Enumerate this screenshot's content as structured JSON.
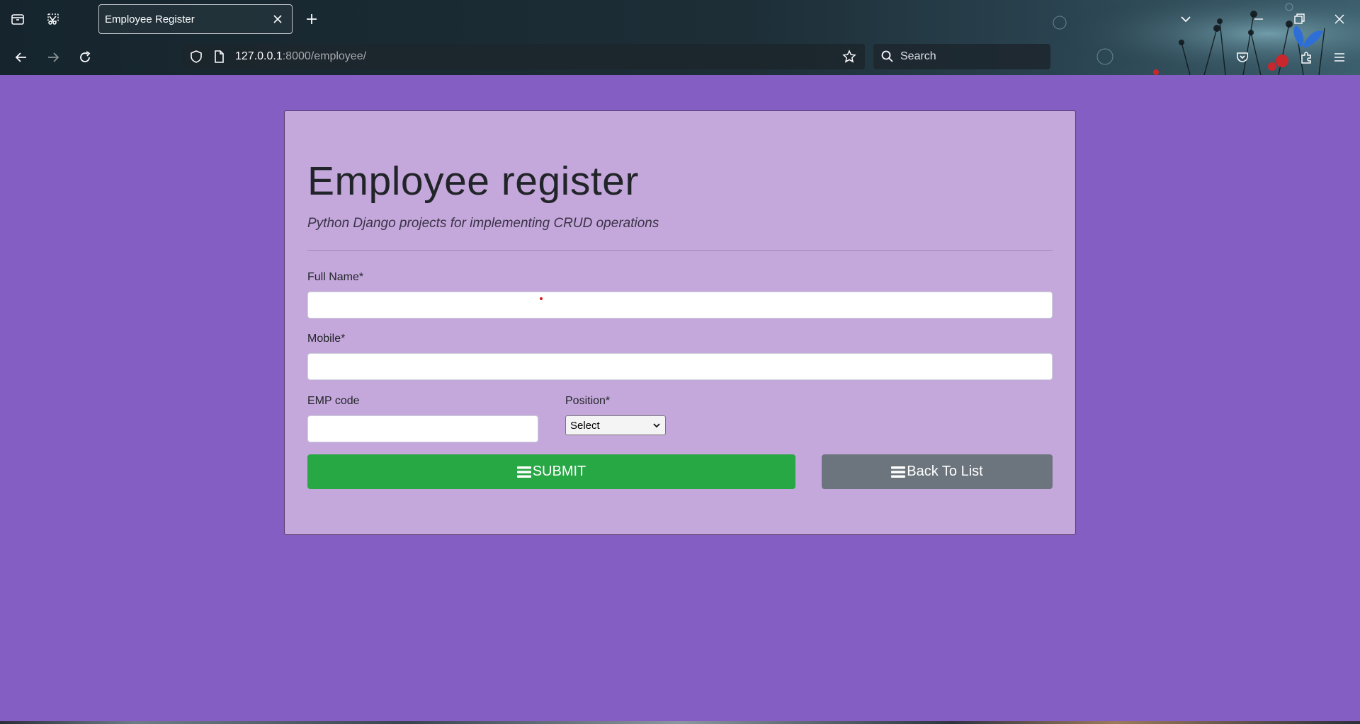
{
  "browser": {
    "tab": {
      "title": "Employee Register"
    },
    "address_bar": {
      "host": "127.0.0.1",
      "path": ":8000/employee/"
    },
    "search": {
      "placeholder": "Search"
    },
    "icons": {
      "tab_list": "tab-list-icon",
      "screenshot": "screenshot-icon",
      "tab_close": "close-icon",
      "new_tab": "plus-icon",
      "list_all_tabs": "chevron-down-icon",
      "minimize": "minimize-icon",
      "restore": "restore-icon",
      "close_window": "close-icon",
      "back": "arrow-left-icon",
      "forward": "arrow-right-icon",
      "reload": "reload-icon",
      "tracking_protection": "shield-icon",
      "page_info": "page-icon",
      "bookmark": "star-icon",
      "search": "search-icon",
      "pocket": "pocket-icon",
      "extensions": "puzzle-icon",
      "menu": "hamburger-menu-icon"
    }
  },
  "page": {
    "title": "Employee register",
    "subtitle": "Python Django projects for implementing CRUD operations",
    "form": {
      "full_name": {
        "label": "Full Name*",
        "value": ""
      },
      "mobile": {
        "label": "Mobile*",
        "value": ""
      },
      "emp_code": {
        "label": "EMP code",
        "value": ""
      },
      "position": {
        "label": "Position*",
        "selected": "Select"
      },
      "submit_label": "SUBMIT",
      "back_label": "Back To List"
    }
  },
  "colors": {
    "page_background": "#845ec2",
    "card_background": "#c5a8db",
    "submit_button": "#28a745",
    "back_button": "#6c757d"
  }
}
